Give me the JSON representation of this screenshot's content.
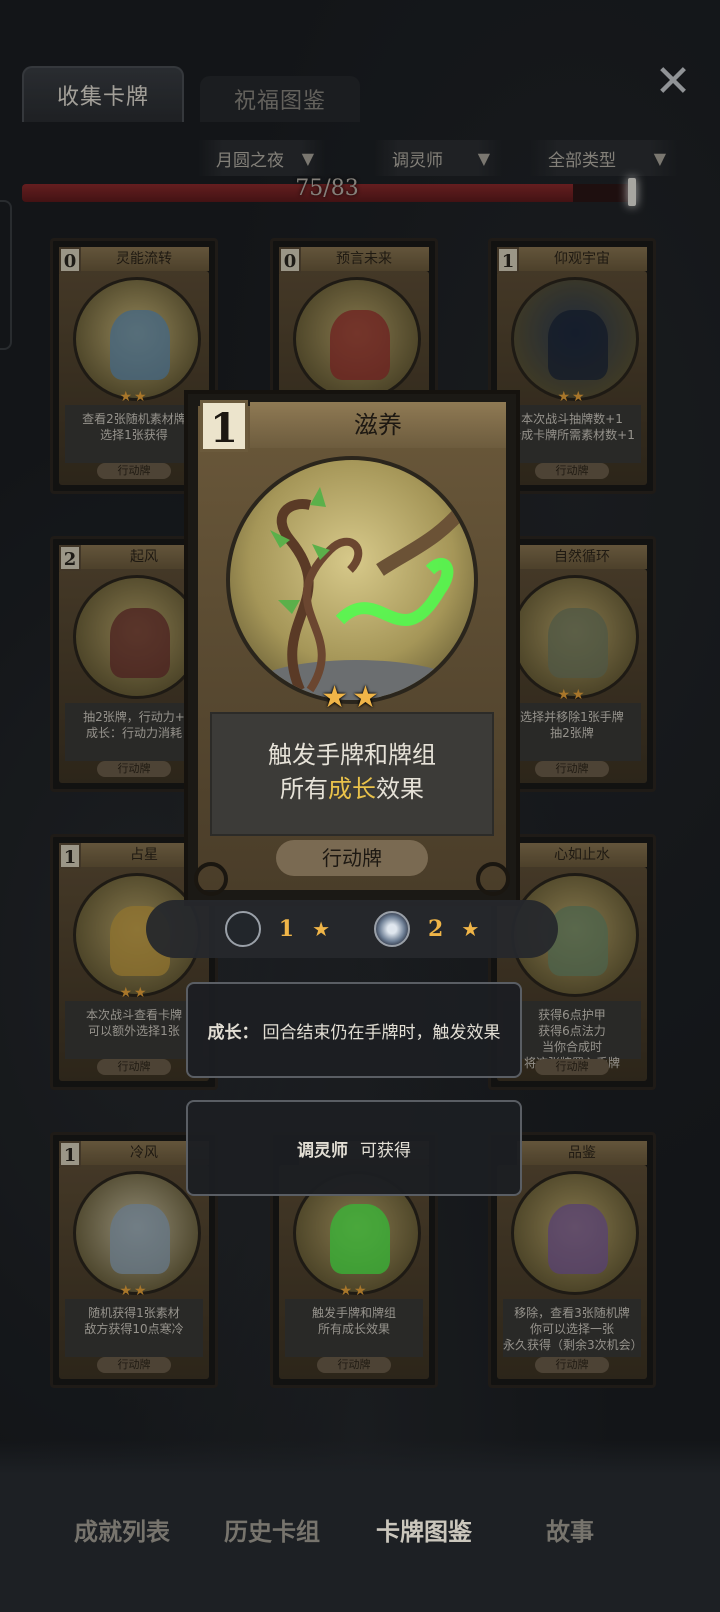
{
  "tabs": {
    "collect": "收集卡牌",
    "blessing": "祝福图鉴"
  },
  "filters": {
    "night": "月圆之夜",
    "class": "调灵师",
    "type": "全部类型"
  },
  "progress": {
    "text": "75/83",
    "current": 75,
    "total": 83
  },
  "cards": [
    {
      "cost": "0",
      "title": "灵能流转",
      "stars": "★★",
      "desc": [
        "查看2张随机素材牌",
        "选择1张获得"
      ],
      "type": "行动牌"
    },
    {
      "cost": "0",
      "title": "预言未来",
      "stars": "",
      "desc": [],
      "type": ""
    },
    {
      "cost": "1",
      "title": "仰观宇宙",
      "stars": "★★",
      "desc": [
        "本次战斗抽牌数+1",
        "合成卡牌所需素材数+1"
      ],
      "type": "行动牌"
    },
    {
      "cost": "2",
      "title": "起风",
      "stars": "",
      "desc": [
        "抽2张牌，行动力+",
        "成长：行动力消耗"
      ],
      "type": "行动牌"
    },
    {
      "cost": "",
      "title": "自然循环",
      "stars": "★★",
      "desc": [
        "选择并移除1张手牌",
        "抽2张牌"
      ],
      "type": "行动牌"
    },
    {
      "cost": "1",
      "title": "占星",
      "stars": "★★",
      "desc": [
        "本次战斗查看卡牌",
        "可以额外选择1张"
      ],
      "type": "行动牌"
    },
    {
      "cost": "",
      "title": "心如止水",
      "stars": "",
      "desc": [
        "获得6点护甲",
        "获得6点法力",
        "当你合成时",
        "将这张牌置入手牌"
      ],
      "type": "行动牌"
    },
    {
      "cost": "1",
      "title": "冷风",
      "stars": "★★",
      "desc": [
        "随机获得1张素材",
        "敌方获得10点寒冷"
      ],
      "type": "行动牌"
    },
    {
      "cost": "",
      "title": "",
      "stars": "★★",
      "desc": [
        "触发手牌和牌组",
        "所有成长效果"
      ],
      "type": "行动牌"
    },
    {
      "cost": "",
      "title": "品鉴",
      "stars": "",
      "desc": [
        "移除，查看3张随机牌",
        "你可以选择一张",
        "永久获得（剩余3次机会）"
      ],
      "type": "行动牌"
    }
  ],
  "detail": {
    "cost": "1",
    "title": "滋养",
    "stars": "★★",
    "desc_line1": "触发手牌和牌组",
    "desc_line2_pre": "所有",
    "desc_line2_hl": "成长",
    "desc_line2_post": "效果",
    "type": "行动牌",
    "upgrade": [
      {
        "num": "1",
        "star": "★"
      },
      {
        "num": "2",
        "star": "★"
      }
    ],
    "keyword_label": "成长：",
    "keyword_text": "回合结束仍在手牌时，触发效果",
    "source_class": "调灵师",
    "source_text": "可获得"
  },
  "bottom_nav": [
    "成就列表",
    "历史卡组",
    "卡牌图鉴",
    "故事"
  ],
  "colors": {
    "gold": "#f0b548",
    "highlight": "#e9c24a",
    "progress_red": "#8c2a2c"
  },
  "icons": {
    "close": "close-x-icon",
    "filter": "funnel-icon"
  }
}
